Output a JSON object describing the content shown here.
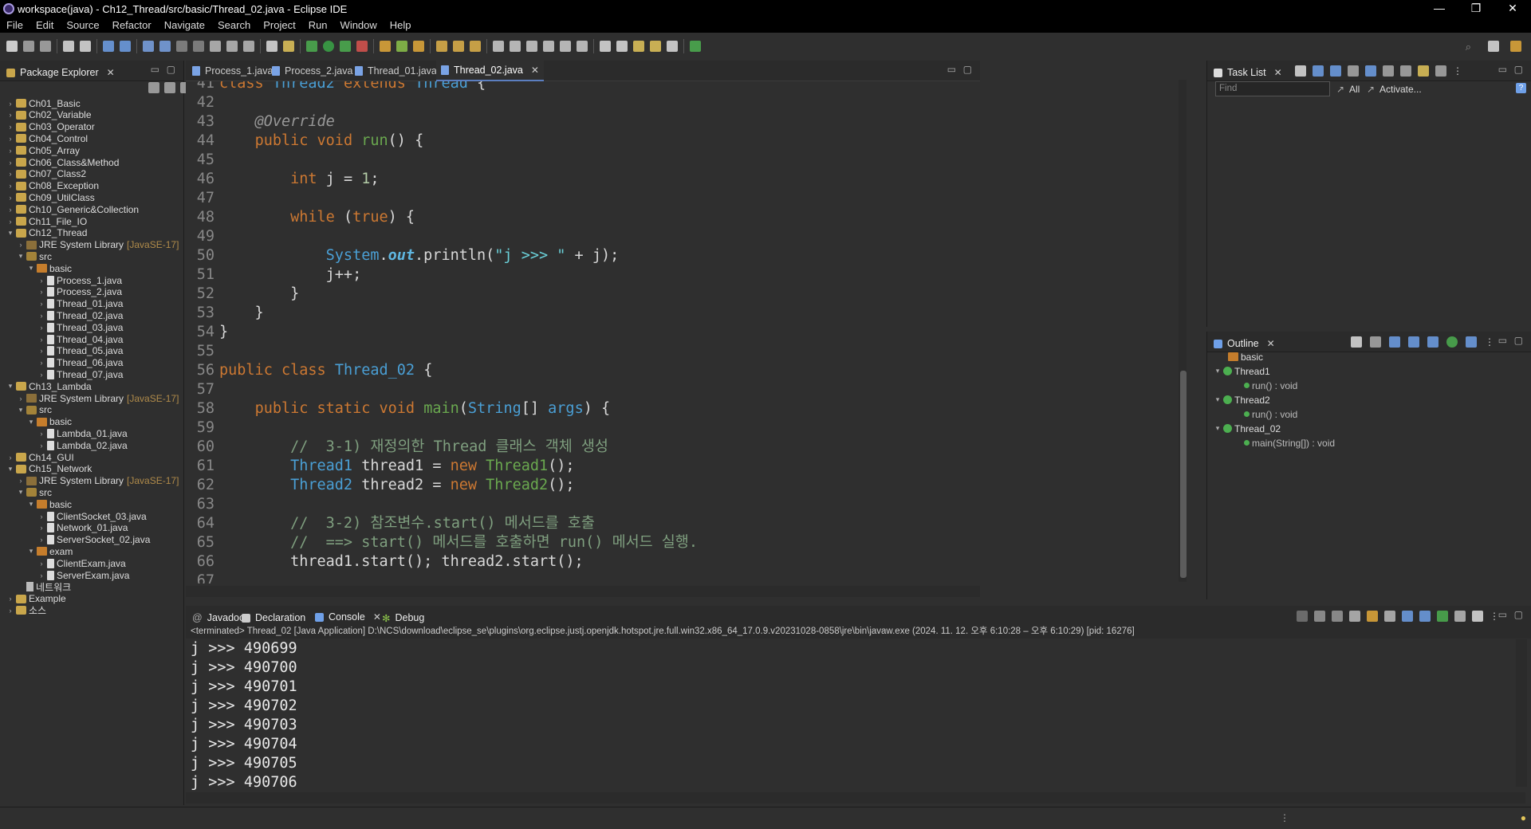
{
  "window": {
    "title": "workspace(java) - Ch12_Thread/src/basic/Thread_02.java - Eclipse IDE"
  },
  "menu": [
    "File",
    "Edit",
    "Source",
    "Refactor",
    "Navigate",
    "Search",
    "Project",
    "Run",
    "Window",
    "Help"
  ],
  "package_explorer": {
    "title": "Package Explorer",
    "items": [
      {
        "label": "Ch01_Basic",
        "jre": ""
      },
      {
        "label": "Ch02_Variable",
        "jre": ""
      },
      {
        "label": "Ch03_Operator",
        "jre": ""
      },
      {
        "label": "Ch04_Control",
        "jre": ""
      },
      {
        "label": "Ch05_Array",
        "jre": ""
      },
      {
        "label": "Ch06_Class&Method",
        "jre": ""
      },
      {
        "label": "Ch07_Class2",
        "jre": ""
      },
      {
        "label": "Ch08_Exception",
        "jre": ""
      },
      {
        "label": "Ch09_UtilClass",
        "jre": ""
      },
      {
        "label": "Ch10_Generic&Collection",
        "jre": ""
      },
      {
        "label": "Ch11_File_IO",
        "jre": ""
      },
      {
        "label": "Ch12_Thread",
        "jre": ""
      },
      {
        "label": "JRE System Library",
        "jre": "[JavaSE-17]"
      },
      {
        "label": "src",
        "jre": ""
      },
      {
        "label": "basic",
        "jre": ""
      },
      {
        "label": "Process_1.java",
        "jre": ""
      },
      {
        "label": "Process_2.java",
        "jre": ""
      },
      {
        "label": "Thread_01.java",
        "jre": ""
      },
      {
        "label": "Thread_02.java",
        "jre": ""
      },
      {
        "label": "Thread_03.java",
        "jre": ""
      },
      {
        "label": "Thread_04.java",
        "jre": ""
      },
      {
        "label": "Thread_05.java",
        "jre": ""
      },
      {
        "label": "Thread_06.java",
        "jre": ""
      },
      {
        "label": "Thread_07.java",
        "jre": ""
      },
      {
        "label": "Ch13_Lambda",
        "jre": ""
      },
      {
        "label": "JRE System Library",
        "jre": "[JavaSE-17]"
      },
      {
        "label": "src",
        "jre": ""
      },
      {
        "label": "basic",
        "jre": ""
      },
      {
        "label": "Lambda_01.java",
        "jre": ""
      },
      {
        "label": "Lambda_02.java",
        "jre": ""
      },
      {
        "label": "Ch14_GUI",
        "jre": ""
      },
      {
        "label": "Ch15_Network",
        "jre": ""
      },
      {
        "label": "JRE System Library",
        "jre": "[JavaSE-17]"
      },
      {
        "label": "src",
        "jre": ""
      },
      {
        "label": "basic",
        "jre": ""
      },
      {
        "label": "ClientSocket_03.java",
        "jre": ""
      },
      {
        "label": "Network_01.java",
        "jre": ""
      },
      {
        "label": "ServerSocket_02.java",
        "jre": ""
      },
      {
        "label": "exam",
        "jre": ""
      },
      {
        "label": "ClientExam.java",
        "jre": ""
      },
      {
        "label": "ServerExam.java",
        "jre": ""
      },
      {
        "label": "네트워크",
        "jre": ""
      },
      {
        "label": "Example",
        "jre": ""
      },
      {
        "label": "소스",
        "jre": ""
      }
    ]
  },
  "editor": {
    "tabs": [
      "Process_1.java",
      "Process_2.java",
      "Thread_01.java",
      "Thread_02.java"
    ],
    "active_tab": "Thread_02.java",
    "line_numbers": [
      "41",
      "42",
      "43",
      "44",
      "45",
      "46",
      "47",
      "48",
      "49",
      "50",
      "51",
      "52",
      "53",
      "54",
      "55",
      "56",
      "57",
      "58",
      "59",
      "60",
      "61",
      "62",
      "63",
      "64",
      "65",
      "66",
      "67"
    ]
  },
  "task_list": {
    "title": "Task List",
    "find_placeholder": "Find",
    "all": "All",
    "activate": "Activate..."
  },
  "outline": {
    "title": "Outline",
    "items": [
      "basic",
      "Thread1",
      "run() : void",
      "Thread2",
      "run() : void",
      "Thread_02",
      "main(String[]) : void"
    ]
  },
  "console": {
    "tabs": [
      "Javadoc",
      "Declaration",
      "Console",
      "Debug"
    ],
    "active_tab": "Console",
    "info": "<terminated> Thread_02 [Java Application] D:\\NCS\\download\\eclipse_se\\plugins\\org.eclipse.justj.openjdk.hotspot.jre.full.win32.x86_64_17.0.9.v20231028-0858\\jre\\bin\\javaw.exe  (2024. 11. 12. 오후 6:10:28 – 오후 6:10:29) [pid: 16276]",
    "lines": [
      "j >>> 490699",
      "j >>> 490700",
      "j >>> 490701",
      "j >>> 490702",
      "j >>> 490703",
      "j >>> 490704",
      "j >>> 490705",
      "j >>> 490706"
    ]
  },
  "colors": {
    "keyword": "#cc7832",
    "type": "#4a9fd5",
    "method": "#6aa84f",
    "comment": "#7f9f7f",
    "background": "#2f2f2f"
  }
}
